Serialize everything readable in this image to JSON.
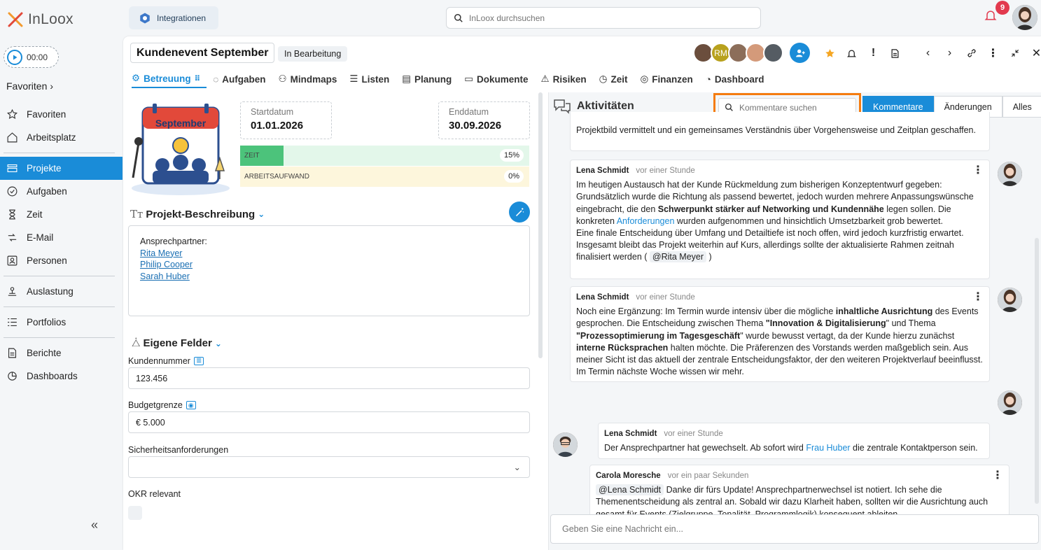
{
  "app": {
    "logo_text": "InLoox"
  },
  "timer": {
    "time": "00:00"
  },
  "sidebar": {
    "favorites_header": "Favoriten",
    "items": [
      {
        "label": "Favoriten",
        "icon": "star-icon"
      },
      {
        "label": "Arbeitsplatz",
        "icon": "home-icon"
      },
      {
        "label": "Projekte",
        "icon": "projects-icon",
        "active": true
      },
      {
        "label": "Aufgaben",
        "icon": "check-circle-icon"
      },
      {
        "label": "Zeit",
        "icon": "hourglass-icon"
      },
      {
        "label": "E-Mail",
        "icon": "email-icon"
      },
      {
        "label": "Personen",
        "icon": "person-icon"
      },
      {
        "label": "Auslastung",
        "icon": "workload-icon"
      },
      {
        "label": "Portfolios",
        "icon": "portfolio-icon"
      },
      {
        "label": "Berichte",
        "icon": "report-icon"
      },
      {
        "label": "Dashboards",
        "icon": "dashboard-icon"
      }
    ],
    "collapse_glyph": "«"
  },
  "topbar": {
    "integrations_label": "Integrationen",
    "search_placeholder": "InLoox durchsuchen",
    "notification_count": "9"
  },
  "project": {
    "title": "Kundenevent September",
    "status": "In Bearbeitung",
    "team_initials": "RM"
  },
  "tabs": [
    {
      "label": "Betreuung",
      "icon": "settings-sliders-icon",
      "active": true
    },
    {
      "label": "Aufgaben",
      "icon": "check-circle-icon"
    },
    {
      "label": "Mindmaps",
      "icon": "mindmap-icon"
    },
    {
      "label": "Listen",
      "icon": "list-icon"
    },
    {
      "label": "Planung",
      "icon": "gantt-icon"
    },
    {
      "label": "Dokumente",
      "icon": "folder-icon"
    },
    {
      "label": "Risiken",
      "icon": "warning-icon"
    },
    {
      "label": "Zeit",
      "icon": "clock-icon"
    },
    {
      "label": "Finanzen",
      "icon": "coins-icon"
    },
    {
      "label": "Dashboard",
      "icon": "pie-chart-icon"
    }
  ],
  "overview": {
    "image_text": "September",
    "start_label": "Startdatum",
    "start_value": "01.01.2026",
    "end_label": "Enddatum",
    "end_value": "30.09.2026",
    "progress": [
      {
        "label": "ZEIT",
        "percent_text": "15%",
        "value": 0.15,
        "color": "#4cc37b",
        "track": "#e3f7ea"
      },
      {
        "label": "ARBEITSAUFWAND",
        "percent_text": "0%",
        "value": 0.0,
        "color": "#f3dd86",
        "track": "#fdf6dc"
      }
    ]
  },
  "description": {
    "title": "Projekt-Beschreibung",
    "contact_label": "Ansprechpartner:",
    "contacts": [
      "Rita Meyer",
      "Philip Cooper",
      "Sarah Huber"
    ]
  },
  "custom_fields": {
    "title": "Eigene Felder",
    "customer_number_label": "Kundennummer",
    "customer_number_value": "123.456",
    "budget_label": "Budgetgrenze",
    "budget_value": "€ 5.000",
    "security_label": "Sicherheitsanforderungen",
    "security_value": "",
    "okr_label": "OKR relevant"
  },
  "activities": {
    "title": "Aktivitäten",
    "search_placeholder": "Kommentare suchen",
    "filters": [
      "Kommentare",
      "Änderungen",
      "Alles"
    ],
    "message_placeholder": "Geben Sie eine Nachricht ein...",
    "partial_comment": "Projektbild vermittelt und ein gemeinsames Verständnis über Vorgehensweise und Zeitplan geschaffen.",
    "comments": [
      {
        "author": "Lena Schmidt",
        "time": "vor einer Stunde",
        "p1": "Im heutigen Austausch hat der Kunde Rückmeldung zum bisherigen Konzeptentwurf gegeben: Grundsätzlich wurde die Richtung als passend bewertet, jedoch wurden mehrere Anpassungswünsche eingebracht, die den ",
        "b1": "Schwerpunkt stärker auf Networking und Kundennähe",
        "p2": " legen sollen. Die konkreten ",
        "link1": "Anforderungen",
        "p3": " wurden aufgenommen und hinsichtlich Umsetzbarkeit grob bewertet.",
        "p4": "Eine finale Entscheidung über Umfang und Detailtiefe ist noch offen, wird jedoch kurzfristig erwartet. Insgesamt bleibt das Projekt weiterhin auf Kurs, allerdings sollte der aktualisierte Rahmen zeitnah finalisiert werden ( ",
        "mention": "@Rita Meyer",
        "p5": " )"
      },
      {
        "author": "Lena Schmidt",
        "time": "vor einer Stunde",
        "p1": "Noch eine Ergänzung: Im Termin wurde intensiv über die mögliche ",
        "b1": "inhaltliche Ausrichtung",
        "p2": " des Events gesprochen. Die Entscheidung zwischen Thema ",
        "b2": "\"Innovation & Digitalisierung",
        "p3": "\" und Thema ",
        "b3": "\"Prozessoptimierung im Tagesgeschäft",
        "p4": "\" wurde bewusst vertagt, da der Kunde hierzu zunächst ",
        "b4": "interne Rücksprachen",
        "p5": " halten möchte. Die Präferenzen des Vorstands werden maßgeblich sein. Aus meiner Sicht ist das aktuell der zentrale Entscheidungsfaktor, der den weiteren Projektverlauf beeinflusst. Im Termin nächste Woche wissen wir mehr."
      },
      {
        "author": "Lena Schmidt",
        "time": "vor einer Stunde",
        "p1": "Der Ansprechpartner hat gewechselt. Ab sofort wird ",
        "link1": "Frau Huber",
        "p2": " die zentrale Kontaktperson sein."
      },
      {
        "author": "Carola Moresche",
        "time": "vor ein paar Sekunden",
        "mention": "@Lena Schmidt",
        "p1": " Danke dir fürs Update! Ansprechpartnerwechsel ist notiert. Ich sehe die Themenentscheidung als zentral an. Sobald wir dazu Klarheit haben, sollten wir die Ausrichtung auch gesamt für Events (Zielgruppe, Tonalität, Programmlogik) konsequent ableiten."
      }
    ]
  }
}
